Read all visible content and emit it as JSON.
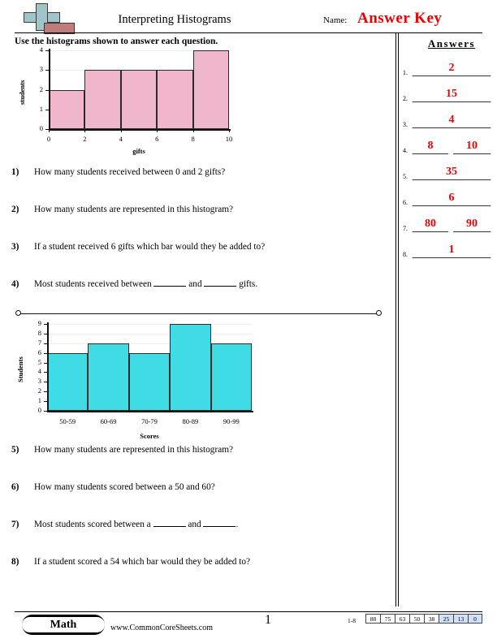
{
  "header": {
    "title": "Interpreting Histograms",
    "name_label": "Name:",
    "answer_key": "Answer Key",
    "instructions": "Use the histograms shown to answer each question."
  },
  "answers_panel": {
    "heading": "Answers",
    "rows": [
      {
        "num": "1.",
        "values": [
          "2"
        ]
      },
      {
        "num": "2.",
        "values": [
          "15"
        ]
      },
      {
        "num": "3.",
        "values": [
          "4"
        ]
      },
      {
        "num": "4.",
        "values": [
          "8",
          "10"
        ]
      },
      {
        "num": "5.",
        "values": [
          "35"
        ]
      },
      {
        "num": "6.",
        "values": [
          "6"
        ]
      },
      {
        "num": "7.",
        "values": [
          "80",
          "90"
        ]
      },
      {
        "num": "8.",
        "values": [
          "1"
        ]
      }
    ]
  },
  "questions": [
    {
      "num": "1)",
      "text": "How many students received between 0 and 2 gifts?"
    },
    {
      "num": "2)",
      "text": "How many students are represented in this histogram?"
    },
    {
      "num": "3)",
      "text": "If a student received 6 gifts which bar would they be added to?"
    },
    {
      "num": "4)",
      "text": "Most students received between ______ and ______ gifts."
    },
    {
      "num": "5)",
      "text": "How many students are represented in this histogram?"
    },
    {
      "num": "6)",
      "text": "How many students scored between a 50 and 60?"
    },
    {
      "num": "7)",
      "text": "Most students scored between a ______ and ______."
    },
    {
      "num": "8)",
      "text": "If a student scored a 54 which bar would they be added to?"
    }
  ],
  "footer": {
    "subject": "Math",
    "website": "www.CommonCoreSheets.com",
    "page_number": "1",
    "score_range_label": "1-8",
    "score_values": [
      "88",
      "75",
      "63",
      "50",
      "38",
      "25",
      "13",
      "0"
    ],
    "score_highlighted": [
      "25",
      "13",
      "0"
    ]
  },
  "colors": {
    "answer_red": "#ee0000",
    "bar_pink": "#f0b6cb",
    "bar_cyan": "#40dce6",
    "score_highlight": "#cfe0f7"
  },
  "chart_data": [
    {
      "type": "bar",
      "title": "",
      "xlabel": "gifts",
      "ylabel": "students",
      "bin_edges": [
        0,
        2,
        4,
        6,
        8,
        10
      ],
      "categories": [
        "0-2",
        "2-4",
        "4-6",
        "6-8",
        "8-10"
      ],
      "values": [
        2,
        3,
        3,
        3,
        4
      ],
      "xticks": [
        "0",
        "2",
        "4",
        "6",
        "8",
        "10"
      ],
      "yticks": [
        "0",
        "1",
        "2",
        "3",
        "4"
      ],
      "ylim": [
        0,
        4
      ],
      "xlim": [
        0,
        10
      ],
      "grid": true,
      "legend": "none",
      "bar_color": "#f0b6cb"
    },
    {
      "type": "bar",
      "title": "",
      "xlabel": "Scores",
      "ylabel": "Students",
      "categories": [
        "50-59",
        "60-69",
        "70-79",
        "80-89",
        "90-99"
      ],
      "values": [
        6,
        7,
        6,
        9,
        7
      ],
      "yticks": [
        "0",
        "1",
        "2",
        "3",
        "4",
        "5",
        "6",
        "7",
        "8",
        "9"
      ],
      "ylim": [
        0,
        9
      ],
      "grid": true,
      "legend": "none",
      "bar_color": "#40dce6"
    }
  ]
}
